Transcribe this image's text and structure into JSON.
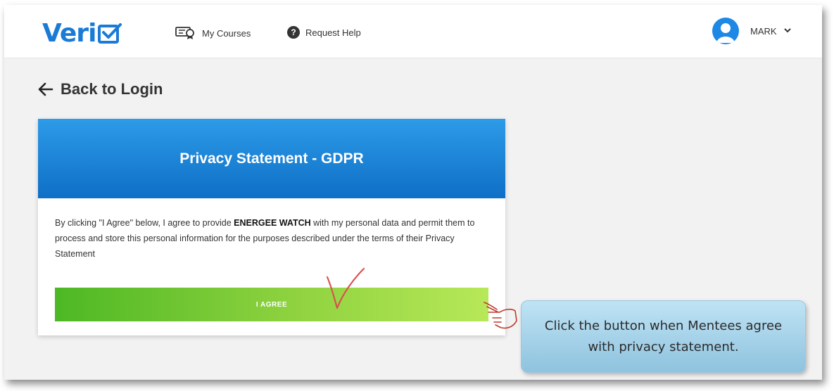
{
  "app": {
    "logo_text": "Veri",
    "brand_color": "#1a7bd6"
  },
  "nav": {
    "my_courses_label": "My Courses",
    "my_courses_icon": "certificate-icon",
    "request_help_label": "Request Help",
    "request_help_icon": "question-circle-icon"
  },
  "user": {
    "name": "MARK",
    "avatar_icon": "user-avatar-icon",
    "menu_icon": "chevron-down-icon"
  },
  "back_link": {
    "label": "Back to Login",
    "icon": "arrow-left-icon"
  },
  "privacy_card": {
    "title": "Privacy Statement - GDPR",
    "body_before": "By clicking \"I Agree\" below, I agree to provide ",
    "body_bold": "ENERGEE WATCH",
    "body_after": " with my personal data and permit them to process and store this personal information for the purposes described under the terms of their Privacy Statement",
    "agree_button_label": "I AGREE",
    "header_color": "#1a86d9",
    "button_color": "#7cc736"
  },
  "annotation": {
    "callout_text": "Click the button when Mentees agree with privacy statement.",
    "checkmark_color": "#d9534f",
    "hand_icon": "pointing-hand-icon"
  }
}
